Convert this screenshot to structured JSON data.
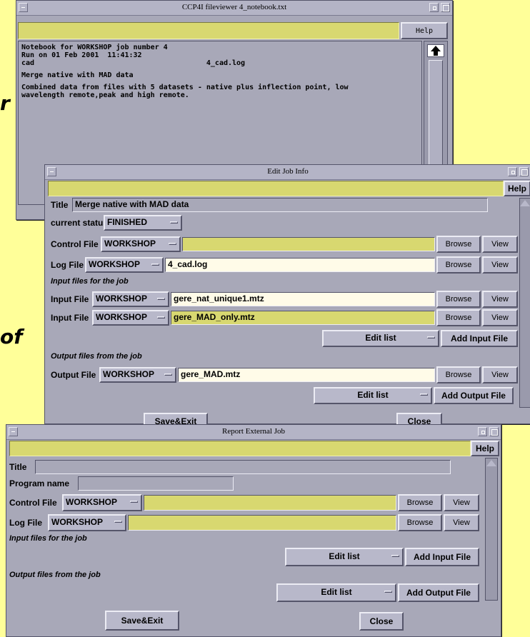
{
  "colors": {
    "background": "#ffff99",
    "window": "#a8a8b8",
    "field_yellow": "#d8d870",
    "field_white": "#fffbe8"
  },
  "bg_fragments": {
    "a": "r",
    "b": "of"
  },
  "fileviewer": {
    "title": "CCP4I fileviewer 4_notebook.txt",
    "help": "Help",
    "lines": [
      "Notebook for WORKSHOP job number 4",
      "Run on 01 Feb 2001  11:41:32",
      "cad                                        4_cad.log",
      "",
      "Merge native with MAD data",
      "",
      "Combined data from files with 5 datasets - native plus inflection point, low",
      "wavelength remote,peak and high remote."
    ]
  },
  "edit_job": {
    "title": "Edit Job Info",
    "help": "Help",
    "title_label": "Title",
    "title_value": "Merge native with MAD data",
    "status_label": "current status",
    "status_value": "FINISHED",
    "control_label": "Control File",
    "control_dir": "WORKSHOP",
    "control_value": "",
    "log_label": "Log File",
    "log_dir": "WORKSHOP",
    "log_value": "4_cad.log",
    "input_heading": "Input files for the job",
    "input_label": "Input File",
    "input1_dir": "WORKSHOP",
    "input1_value": "gere_nat_unique1.mtz",
    "input2_dir": "WORKSHOP",
    "input2_value": "gere_MAD_only.mtz",
    "edit_list": "Edit list",
    "add_input": "Add Input File",
    "output_heading": "Output files from the job",
    "output_label": "Output File",
    "output_dir": "WORKSHOP",
    "output_value": "gere_MAD.mtz",
    "add_output": "Add Output File",
    "browse": "Browse",
    "view": "View",
    "save_exit": "Save&Exit",
    "close": "Close"
  },
  "report": {
    "title": "Report External Job",
    "help": "Help",
    "title_label": "Title",
    "program_label": "Program name",
    "control_label": "Control File",
    "control_dir": "WORKSHOP",
    "log_label": "Log File",
    "log_dir": "WORKSHOP",
    "input_heading": "Input files for the job",
    "output_heading": "Output files from the job",
    "edit_list": "Edit list",
    "add_input": "Add Input File",
    "add_output": "Add Output File",
    "browse": "Browse",
    "view": "View",
    "save_exit": "Save&Exit",
    "close": "Close"
  }
}
